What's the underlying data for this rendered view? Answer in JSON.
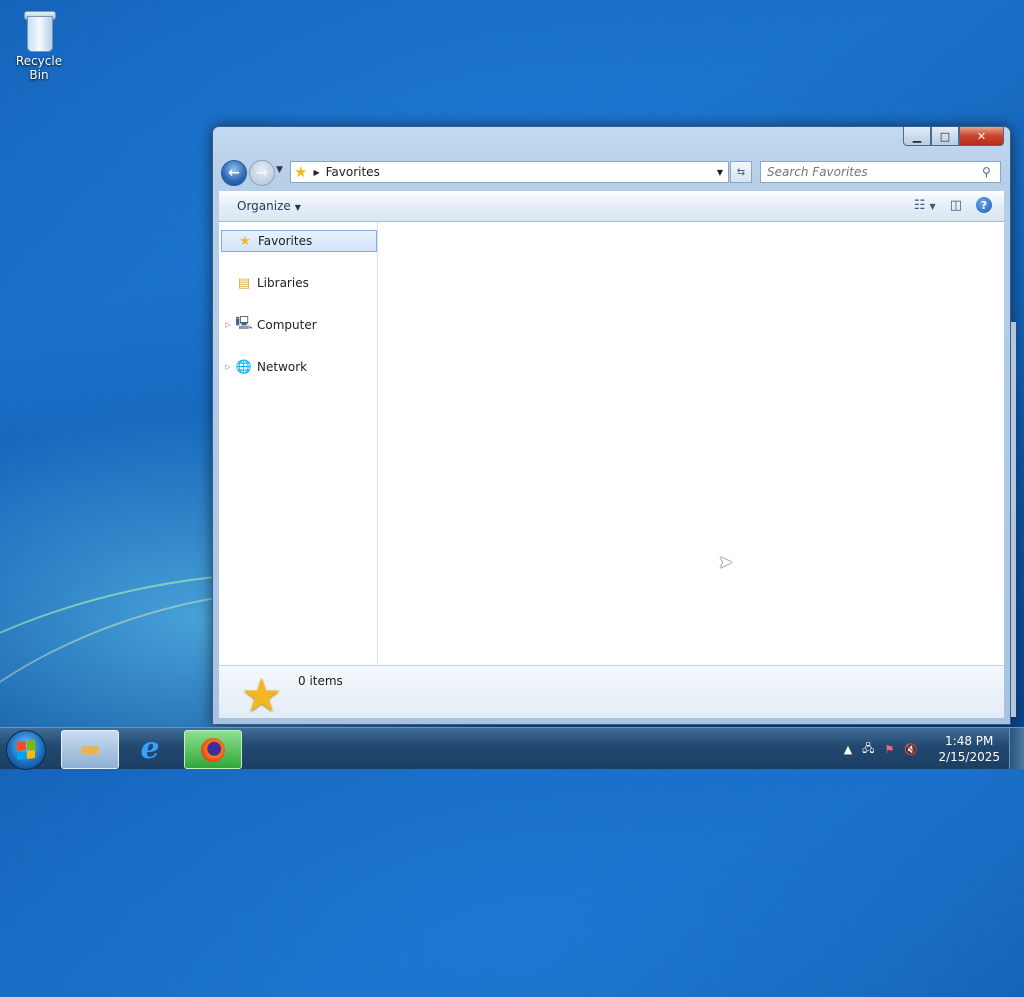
{
  "desktop": {
    "recycle_bin_label": "Recycle Bin"
  },
  "window": {
    "address": {
      "location": "Favorites"
    },
    "search": {
      "placeholder": "Search Favorites"
    },
    "toolbar": {
      "organize_label": "Organize"
    },
    "nav_pane": {
      "items": [
        {
          "label": "Favorites",
          "icon": "star-icon",
          "selected": true
        },
        {
          "label": "Libraries",
          "icon": "libraries-icon"
        },
        {
          "label": "Computer",
          "icon": "computer-icon"
        },
        {
          "label": "Network",
          "icon": "network-icon"
        }
      ]
    },
    "status": {
      "item_count": "0 items"
    }
  },
  "taskbar": {
    "pinned": [
      {
        "name": "windows-explorer",
        "icon": "folder-icon"
      },
      {
        "name": "internet-explorer",
        "icon": "ie-icon"
      },
      {
        "name": "firefox",
        "icon": "firefox-icon"
      }
    ],
    "clock": {
      "time": "1:48 PM",
      "date": "2/15/2025"
    }
  },
  "colors": {
    "accent": "#1b5fb4",
    "close_button": "#c7452c",
    "star": "#f3b721"
  }
}
